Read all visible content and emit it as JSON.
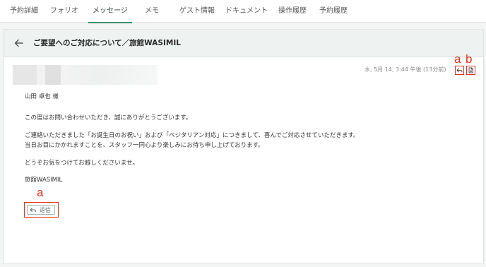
{
  "tabs": [
    {
      "label": "予約詳細"
    },
    {
      "label": "フォリオ"
    },
    {
      "label": "メッセージ",
      "active": true
    },
    {
      "label": "メモ"
    },
    {
      "label": "ゲスト情報"
    },
    {
      "label": "ドキュメント"
    },
    {
      "label": "操作履歴"
    },
    {
      "label": "予約履歴"
    }
  ],
  "message": {
    "title": "ご要望へのご対応について／旅館WASIMIL",
    "timestamp": "水, 5月 14, 3:44 午後 (13分前)",
    "body_lines": [
      "山田 卓也 様",
      "この度はお問い合わせいただき、誠にありがとうございます。",
      "ご連絡いただきました「お誕生日のお祝い」および「ベジタリアン対応」につきまして、喜んでご対応させていただきます。",
      "当日お目にかかれますことを、スタッフ一同心より楽しみにお待ち申し上げております。",
      "どうぞお気をつけてお越しくださいませ。",
      "旅館WASIMIL"
    ],
    "reply_label": "返信"
  },
  "annotations": {
    "reply_icon_label": "a",
    "print_icon_label": "b",
    "reply_button_label": "a"
  },
  "icons": {
    "back": "arrow-left-icon",
    "reply": "reply-arrow-icon",
    "print": "document-icon"
  },
  "colors": {
    "accent": "#3f8f6d",
    "header_bg": "#eef3f1",
    "annotation": "#e0321b"
  }
}
